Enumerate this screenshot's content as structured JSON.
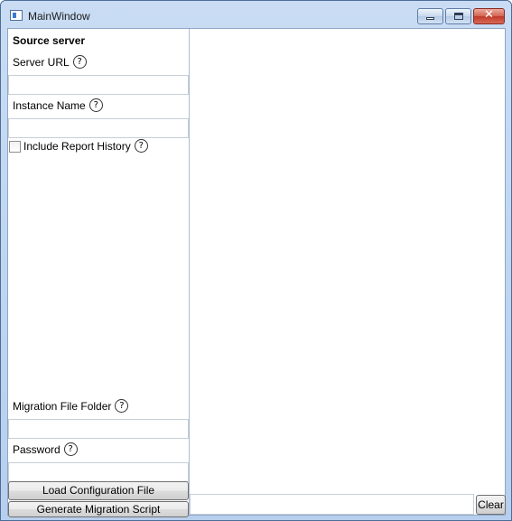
{
  "window": {
    "title": "MainWindow",
    "close_glyph": "✕"
  },
  "source": {
    "section_title": "Source server",
    "server_url_label": "Server URL",
    "server_url_value": "",
    "instance_name_label": "Instance Name",
    "instance_name_value": "",
    "include_history_label": "Include Report History",
    "include_history_checked": false
  },
  "migration": {
    "folder_label": "Migration File Folder",
    "folder_value": "",
    "password_label": "Password",
    "password_value": ""
  },
  "actions": {
    "load_config": "Load Configuration File",
    "generate_script": "Generate Migration Script",
    "clear": "Clear"
  },
  "help_glyph": "?",
  "icons": {
    "app": "app-window-icon",
    "help": "question-help-icon",
    "minimize": "minimize-icon",
    "maximize": "maximize-icon",
    "close": "close-icon"
  }
}
